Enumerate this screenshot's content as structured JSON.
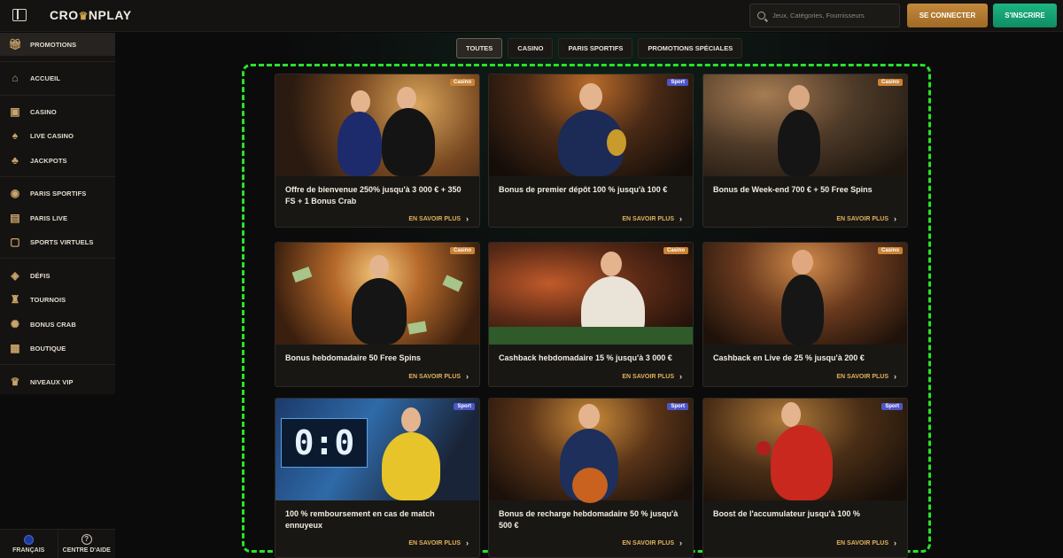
{
  "header": {
    "logo": "CROWNPLAY",
    "logo_pre": "CRO",
    "logo_post": "NPLAY",
    "search_placeholder": "Jeux, Catégories, Fournisseurs",
    "login_label": "SE CONNECTER",
    "signup_label": "S'INSCRIRE"
  },
  "sidebar": {
    "items": [
      {
        "label": "PROMOTIONS",
        "icon": "gift-icon"
      },
      {
        "label": "ACCUEIL",
        "icon": "home-icon"
      },
      {
        "label": "CASINO",
        "icon": "slot-machine-icon"
      },
      {
        "label": "LIVE CASINO",
        "icon": "spade-icon"
      },
      {
        "label": "JACKPOTS",
        "icon": "clover-icon"
      },
      {
        "label": "PARIS SPORTIFS",
        "icon": "ball-icon"
      },
      {
        "label": "PARIS LIVE",
        "icon": "live-icon"
      },
      {
        "label": "SPORTS VIRTUELS",
        "icon": "gamepad-icon"
      },
      {
        "label": "DÉFIS",
        "icon": "challenge-icon"
      },
      {
        "label": "TOURNOIS",
        "icon": "trophy-icon"
      },
      {
        "label": "BONUS CRAB",
        "icon": "crab-icon"
      },
      {
        "label": "BOUTIQUE",
        "icon": "shop-icon"
      },
      {
        "label": "NIVEAUX VIP",
        "icon": "crown-icon"
      }
    ],
    "language": "FRANÇAIS",
    "help": "CENTRE D'AIDE"
  },
  "tabs": [
    {
      "label": "TOUTES",
      "active": true
    },
    {
      "label": "CASINO",
      "active": false
    },
    {
      "label": "PARIS SPORTIFS",
      "active": false
    },
    {
      "label": "PROMOTIONS SPÉCIALES",
      "active": false
    }
  ],
  "cards": [
    {
      "badge": "Casino",
      "title": "Offre de bienvenue 250% jusqu'à 3 000 € + 350 FS + 1 Bonus Crab",
      "more": "EN SAVOIR PLUS"
    },
    {
      "badge": "Sport",
      "title": "Bonus de premier dépôt 100 % jusqu'à 100 €",
      "more": "EN SAVOIR PLUS"
    },
    {
      "badge": "Casino",
      "title": "Bonus de Week-end 700 € + 50 Free Spins",
      "more": "EN SAVOIR PLUS"
    },
    {
      "badge": "Casino",
      "title": "Bonus hebdomadaire 50 Free Spins",
      "more": "EN SAVOIR PLUS"
    },
    {
      "badge": "Casino",
      "title": "Cashback hebdomadaire 15 % jusqu'à 3 000 €",
      "more": "EN SAVOIR PLUS"
    },
    {
      "badge": "Casino",
      "title": "Cashback en Live de 25 % jusqu'à 200 €",
      "more": "EN SAVOIR PLUS"
    },
    {
      "badge": "Sport",
      "title": "100 % remboursement en cas de match ennuyeux",
      "more": "EN SAVOIR PLUS"
    },
    {
      "badge": "Sport",
      "title": "Bonus de recharge hebdomadaire 50 % jusqu'à 500 €",
      "more": "EN SAVOIR PLUS"
    },
    {
      "badge": "Sport",
      "title": "Boost de l'accumulateur jusqu'à 100 %",
      "more": "EN SAVOIR PLUS"
    }
  ],
  "scoreboard": "0:0",
  "colors": {
    "accent_gold": "#e2b15a",
    "login_button": "#c48a3c",
    "signup_button": "#1db584",
    "highlight_frame": "#2ae12a",
    "badge_casino": "#c98336",
    "badge_sport": "#4e55c8"
  }
}
